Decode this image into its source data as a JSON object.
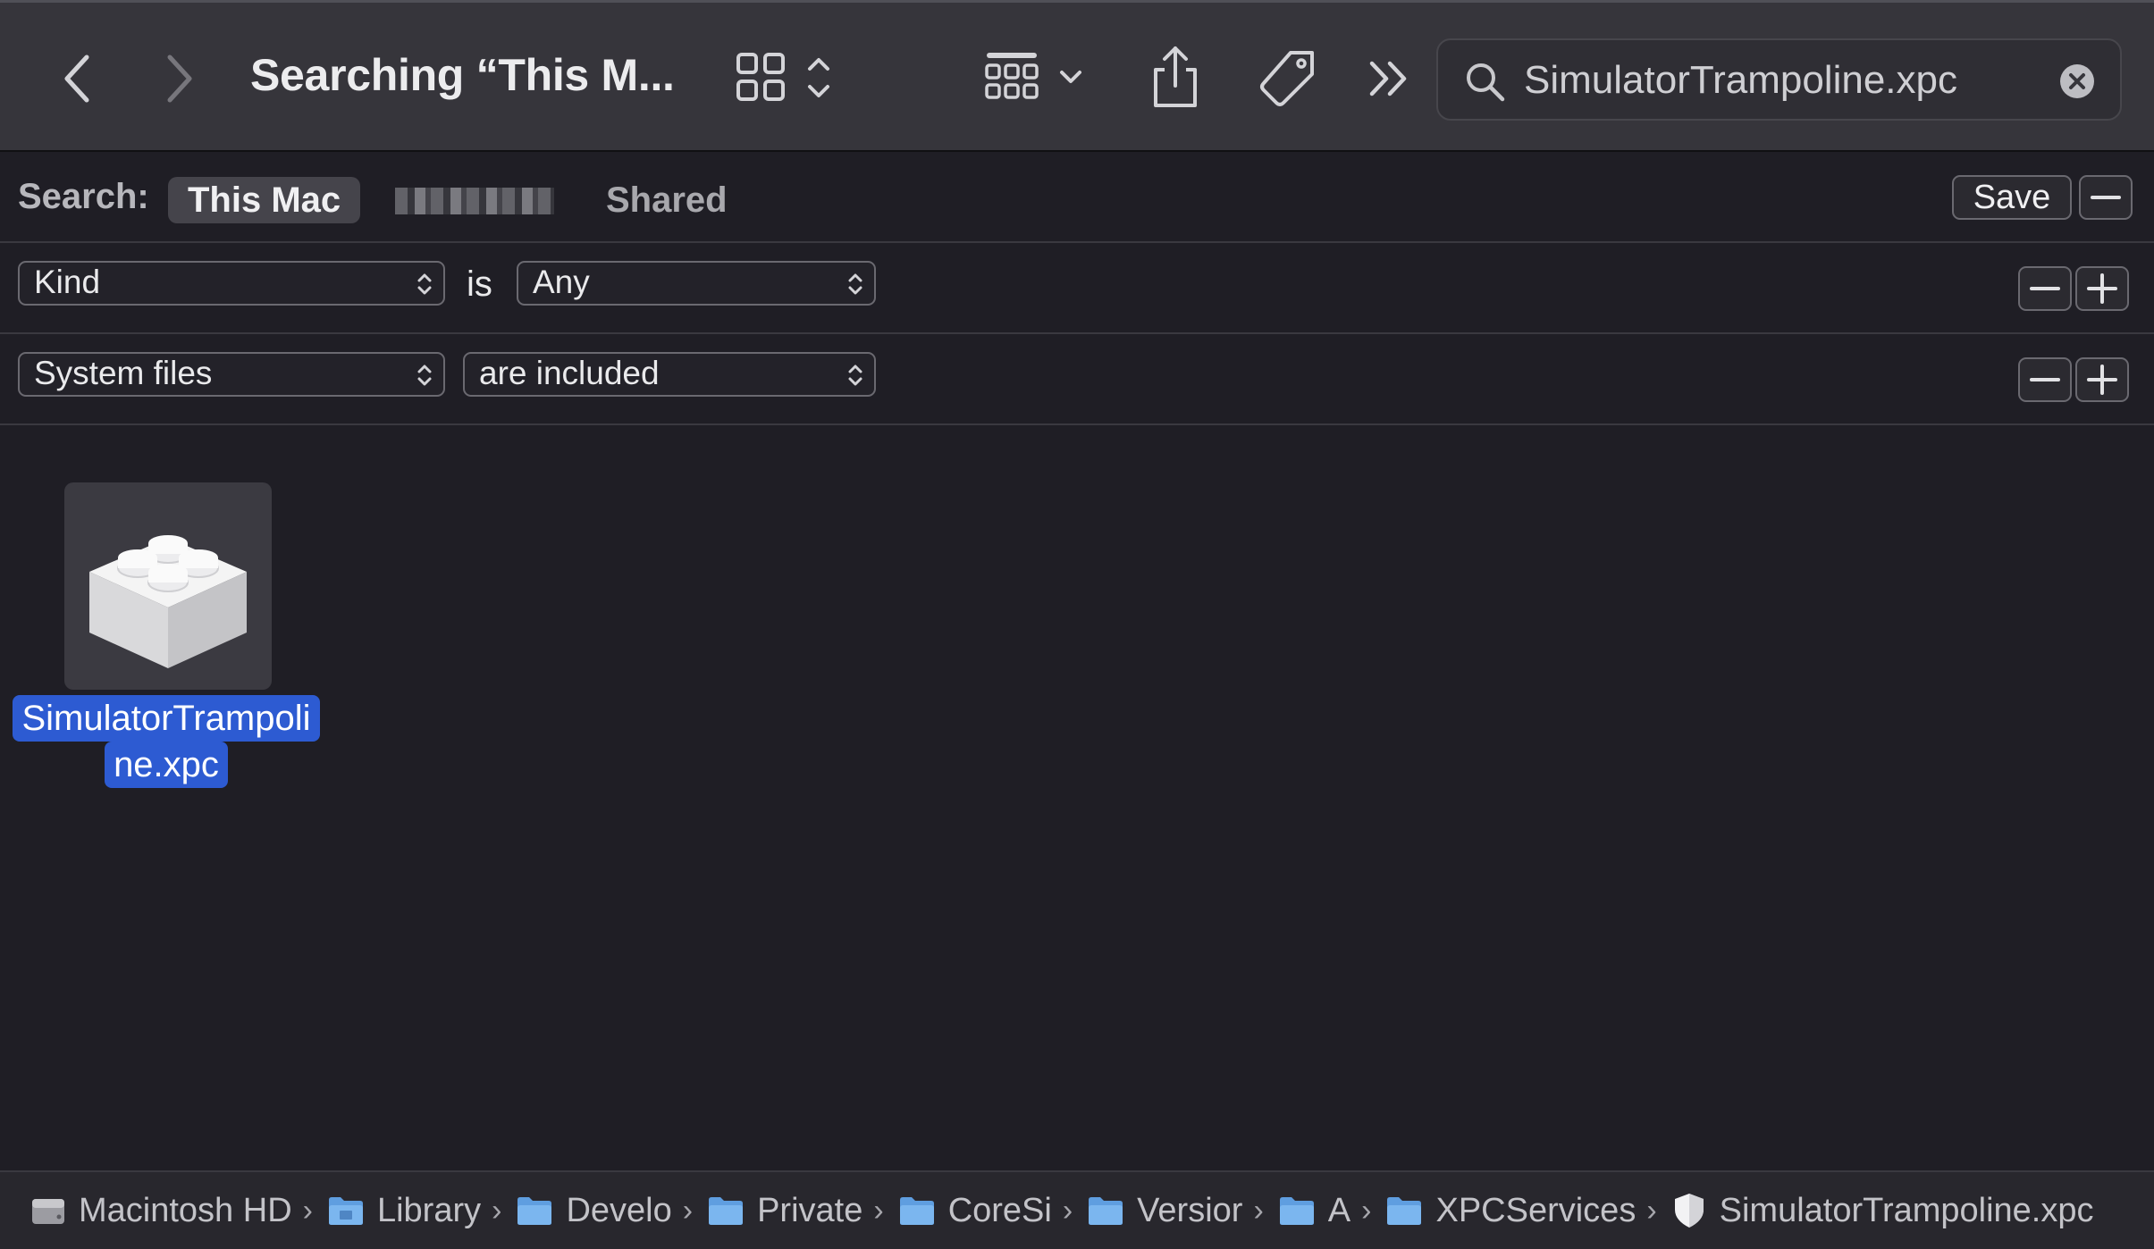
{
  "toolbar": {
    "title": "Searching “This M...",
    "search_value": "SimulatorTrampoline.xpc"
  },
  "scope_bar": {
    "label": "Search:",
    "options": [
      "This Mac",
      "",
      "Shared"
    ],
    "save_label": "Save"
  },
  "criteria": [
    {
      "attribute": "Kind",
      "operator": "is",
      "value": "Any"
    },
    {
      "attribute": "System files",
      "operator": "",
      "value": "are included"
    }
  ],
  "results": [
    {
      "name_line1": "SimulatorTrampoli",
      "name_line2": "ne.xpc",
      "selected": true,
      "icon": "xpc-bundle-icon"
    }
  ],
  "path_bar": {
    "items": [
      {
        "label": "Macintosh HD",
        "icon": "hard-drive-icon"
      },
      {
        "label": "Library",
        "icon": "folder-icon"
      },
      {
        "label": "Develo",
        "icon": "folder-icon"
      },
      {
        "label": "Private",
        "icon": "folder-icon"
      },
      {
        "label": "CoreSi",
        "icon": "folder-icon"
      },
      {
        "label": "Versior",
        "icon": "folder-icon"
      },
      {
        "label": "A",
        "icon": "folder-icon"
      },
      {
        "label": "XPCServices",
        "icon": "folder-icon"
      },
      {
        "label": "SimulatorTrampoline.xpc",
        "icon": "shield-icon"
      }
    ]
  },
  "colors": {
    "toolbar_bg": "#36353b",
    "window_bg": "#1f1e25",
    "selection": "#2d5bd2",
    "folder": "#6aa8e8"
  }
}
